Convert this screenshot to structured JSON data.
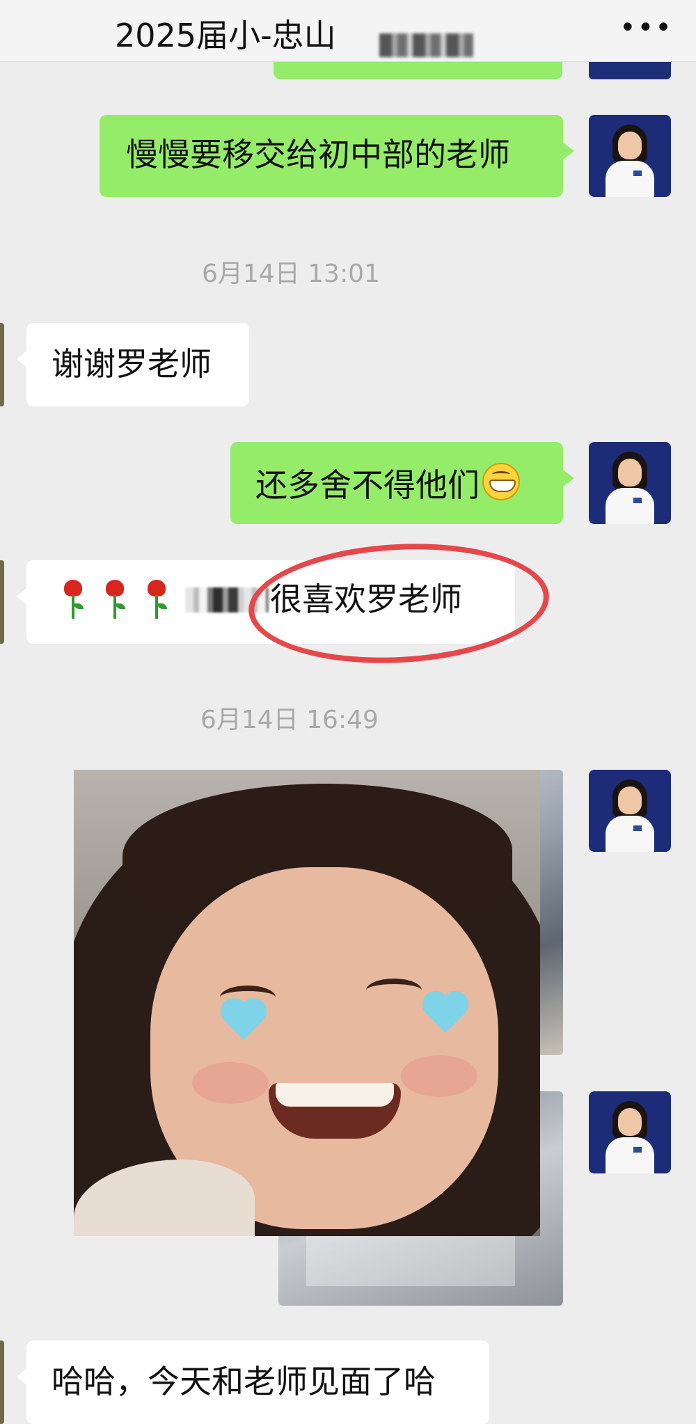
{
  "header": {
    "title": "2025届小-忠山",
    "more_icon": "more-dots-icon",
    "more_glyph": "•••"
  },
  "messages": [
    {
      "text": "慢慢要移交给初中部的老师"
    },
    {
      "timestamp": "6月14日 13:01"
    },
    {
      "text": "谢谢罗老师"
    },
    {
      "text": "还多舍不得他们",
      "emoji": "grinning-face-icon"
    },
    {
      "text": "很喜欢罗老师",
      "emoji": "rose-icon"
    },
    {
      "timestamp": "6月14日 16:49"
    },
    {
      "text": "哈哈，今天和老师见面了哈"
    }
  ],
  "colors": {
    "my_bubble": "#95ec69",
    "other_bubble": "#ffffff",
    "background": "#ededed",
    "annotation_circle": "#e6474a"
  }
}
